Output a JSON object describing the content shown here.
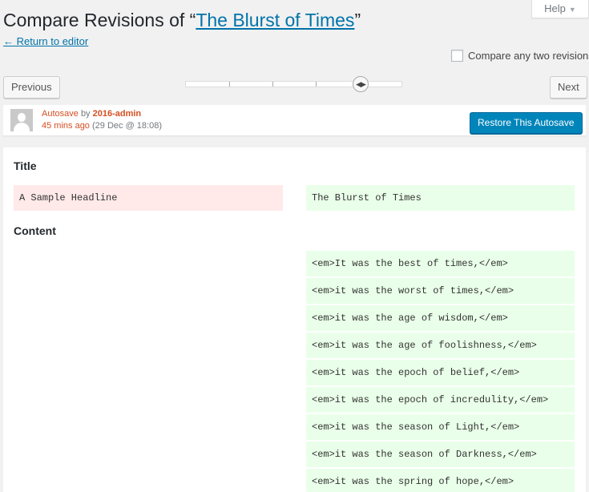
{
  "header": {
    "title_prefix": "Compare Revisions of “",
    "title_link": "The Blurst of Times",
    "title_suffix": "”",
    "return_link": "← Return to editor"
  },
  "help": {
    "label": "Help",
    "caret": "▼"
  },
  "compare_two": {
    "label": "Compare any two revisions",
    "checked": false
  },
  "nav": {
    "previous": "Previous",
    "next": "Next",
    "handle_glyph": "◀▶"
  },
  "meta": {
    "autosave": "Autosave",
    "by": "by",
    "author": "2016-admin",
    "ago": "45 mins ago",
    "date": "(29 Dec @ 18:08)",
    "restore": "Restore This Autosave"
  },
  "diff": {
    "title_heading": "Title",
    "title_old": "A Sample Headline",
    "title_new": "The Blurst of Times",
    "content_heading": "Content",
    "content_new": [
      "<em>It was the best of times,</em>",
      "<em>it was the worst of times,</em>",
      "<em>it was the age of wisdom,</em>",
      "<em>it was the age of foolishness,</em>",
      "<em>it was the epoch of belief,</em>",
      "<em>it was the epoch of incredulity,</em>",
      "<em>it was the season of Light,</em>",
      "<em>it was the season of Darkness,</em>",
      "<em>it was the spring of hope,</em>"
    ]
  },
  "colors": {
    "link": "#0073aa",
    "primary_button": "#0085ba",
    "removed_bg": "#ffe9e9",
    "added_bg": "#e9ffe9",
    "meta_accent": "#d54e21"
  }
}
